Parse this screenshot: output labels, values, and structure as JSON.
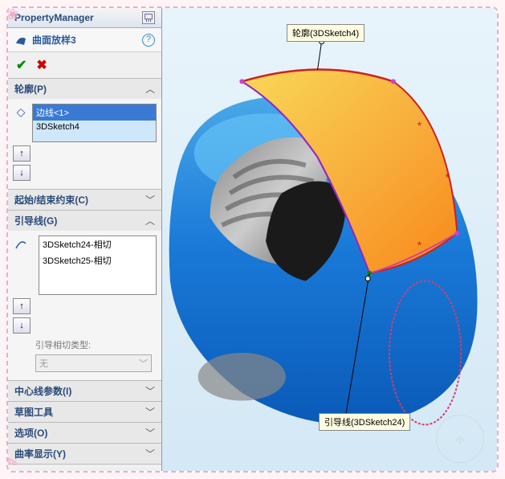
{
  "header": {
    "title": "PropertyManager"
  },
  "feature": {
    "name": "曲面放样3"
  },
  "sections": {
    "profiles": {
      "title": "轮廓(P)",
      "items": [
        "边线<1>",
        "3DSketch4"
      ]
    },
    "constraints": {
      "title": "起始/结束约束(C)"
    },
    "guides": {
      "title": "引导线(G)",
      "items": [
        "3DSketch24-相切",
        "3DSketch25-相切"
      ],
      "tangent_label": "引导相切类型:",
      "tangent_value": "无"
    },
    "centerline": {
      "title": "中心线参数(I)"
    },
    "sketchtools": {
      "title": "草图工具"
    },
    "options": {
      "title": "选项(O)"
    },
    "curvature": {
      "title": "曲率显示(Y)"
    }
  },
  "callouts": {
    "profile": "轮廓(3DSketch4)",
    "guide": "引导线(3DSketch24)"
  }
}
